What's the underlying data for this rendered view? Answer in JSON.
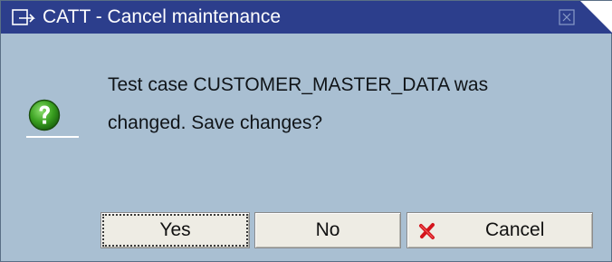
{
  "dialog": {
    "title": "CATT - Cancel maintenance",
    "title_icon": "window-menu-icon",
    "close_icon": "close-icon",
    "message_line1": "Test case CUSTOMER_MASTER_DATA was",
    "message_line2": "changed. Save changes?",
    "message_icon": "question-icon"
  },
  "buttons": {
    "yes_label": "Yes",
    "no_label": "No",
    "cancel_label": "Cancel",
    "cancel_icon": "red-x-icon"
  },
  "colors": {
    "titlebar": "#2c3e8c",
    "body": "#a9bfd2",
    "button_face": "#eeece4",
    "question_icon": "#3aa020",
    "cancel_icon": "#d4141c"
  }
}
